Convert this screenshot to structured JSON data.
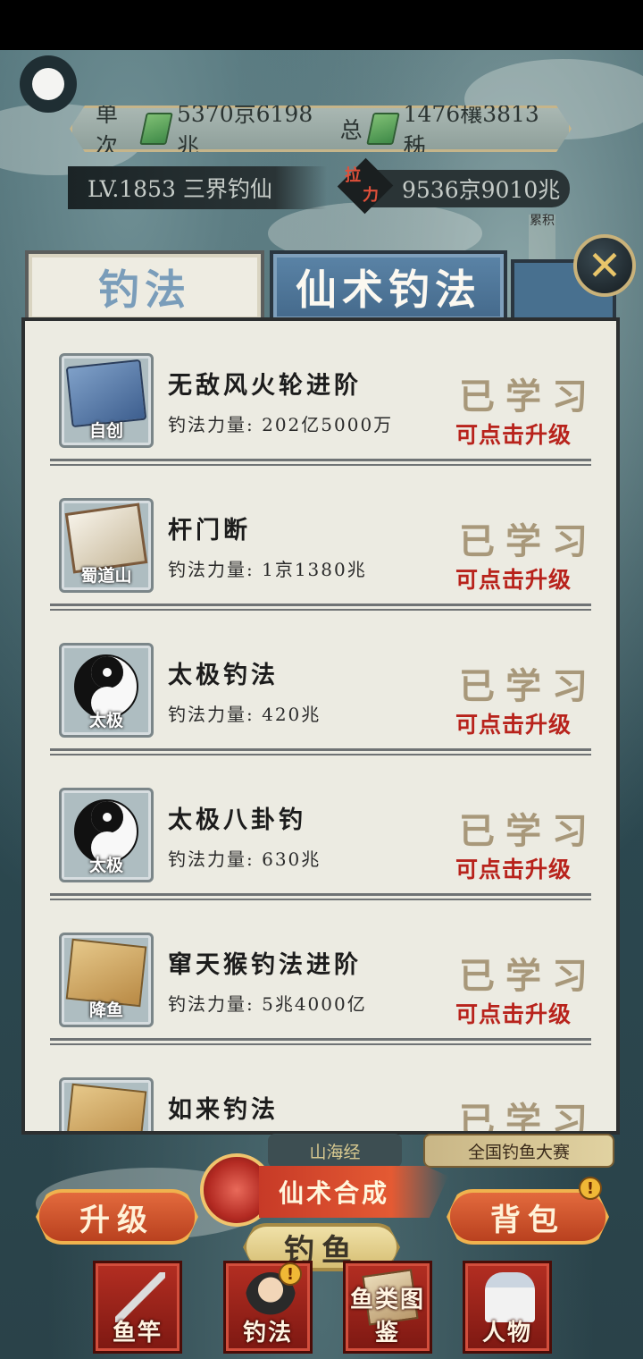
{
  "header": {
    "single_label": "单次",
    "single_value": "5370京6198兆",
    "total_label": "总",
    "total_value": "1476穰3813秭",
    "level": "LV.1853 三界钓仙",
    "power_tag_top": "拉",
    "power_tag_bottom": "力",
    "power_value": "9536京9010兆",
    "side_deco": "累积"
  },
  "tabs": [
    {
      "label": "钓法",
      "active": false
    },
    {
      "label": "仙术钓法",
      "active": true
    }
  ],
  "close_label": "✕",
  "skills": [
    {
      "name": "无敌风火轮进阶",
      "power_label": "钓法力量:",
      "power_value": "202亿5000万",
      "icon_tag": "自创",
      "icon": "book-icon",
      "status": "已学习",
      "action": "可点击升级"
    },
    {
      "name": "杆门断",
      "power_label": "钓法力量:",
      "power_value": "1京1380兆",
      "icon_tag": "蜀道山",
      "icon": "scroll-icon",
      "status": "已学习",
      "action": "可点击升级"
    },
    {
      "name": "太极钓法",
      "power_label": "钓法力量:",
      "power_value": "420兆",
      "icon_tag": "太极",
      "icon": "taiji-icon",
      "status": "已学习",
      "action": "可点击升级"
    },
    {
      "name": "太极八卦钓",
      "power_label": "钓法力量:",
      "power_value": "630兆",
      "icon_tag": "太极",
      "icon": "taiji-icon",
      "status": "已学习",
      "action": "可点击升级"
    },
    {
      "name": "窜天猴钓法进阶",
      "power_label": "钓法力量:",
      "power_value": "5兆4000亿",
      "icon_tag": "降鱼",
      "icon": "card-icon",
      "status": "已学习",
      "action": "可点击升级"
    },
    {
      "name": "如来钓法",
      "power_label": "",
      "power_value": "",
      "icon_tag": "",
      "icon": "card-icon",
      "status": "已学习",
      "action": ""
    }
  ],
  "bottom": {
    "mountain_label": "山海经",
    "contest_label": "全国钓鱼大赛",
    "synth_label": "仙术合成",
    "upgrade_label": "升级",
    "fish_label": "钓鱼",
    "bag_label": "背包",
    "badge": "!"
  },
  "nav": [
    {
      "label": "鱼竿",
      "icon": "fishing-rod-icon"
    },
    {
      "label": "钓法",
      "icon": "fisherman-icon"
    },
    {
      "label": "鱼类图鉴",
      "icon": "codex-icon"
    },
    {
      "label": "人物",
      "icon": "character-icon"
    }
  ]
}
